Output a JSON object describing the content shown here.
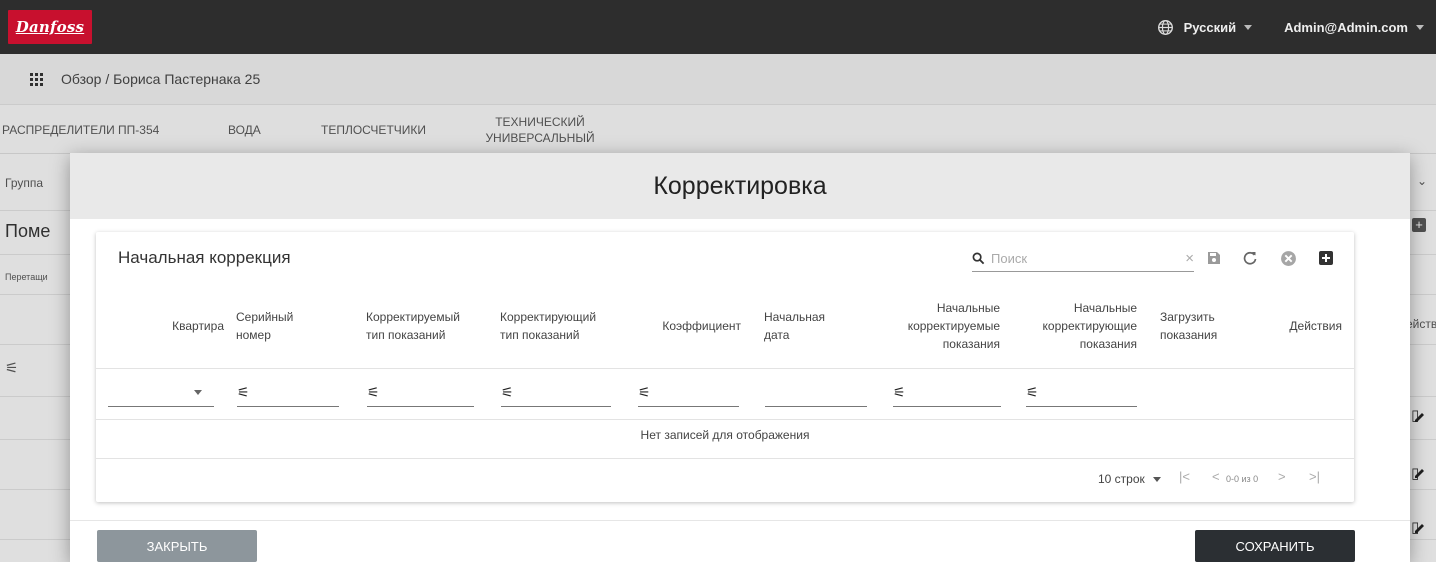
{
  "header": {
    "logo_text": "Danfoss",
    "language": "Русский",
    "user": "Admin@Admin.com"
  },
  "breadcrumb": {
    "text": "Обзор / Бориса Пастернака 25"
  },
  "tabs": [
    {
      "label": "РАСПРЕДЕЛИТЕЛИ ПП-354"
    },
    {
      "label": "ВОДА"
    },
    {
      "label": "ТЕПЛОСЧЕТЧИКИ"
    },
    {
      "label": "ТЕХНИЧЕСКИЙ УНИВЕРСАЛЬНЫЙ"
    }
  ],
  "background_page": {
    "group_label": "Группа",
    "section_title": "Поме",
    "drag_hint": "Перетащи",
    "actions_header": "ействия"
  },
  "modal": {
    "title": "Корректировка",
    "card_title": "Начальная коррекция",
    "search_placeholder": "Поиск",
    "columns": [
      "Квартира",
      "Серийный номер",
      "Корректируемый тип показаний",
      "Корректирующий тип показаний",
      "Коэффициент",
      "Начальная дата",
      "Начальные корректируемые показания",
      "Начальные корректирующие показания",
      "Загрузить показания",
      "Действия"
    ],
    "empty_message": "Нет записей для отображения",
    "rows_per_page": "10 строк",
    "page_range": "0-0 из 0",
    "close_button": "ЗАКРЫТЬ",
    "save_button": "СОХРАНИТЬ"
  },
  "colors": {
    "topbar": "#2d2d2d",
    "logo_bg": "#c8102e",
    "save_button": "#2b2f33",
    "close_button": "#8d969c"
  }
}
